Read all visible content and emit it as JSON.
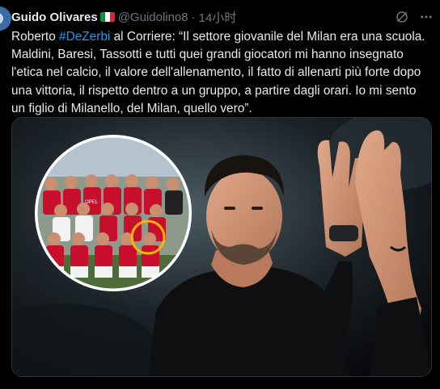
{
  "author": {
    "name": "Guido Olivares",
    "handle": "@Guidolino8",
    "separator": "·",
    "time": "14小时"
  },
  "tweet": {
    "line1_pre": "Roberto ",
    "line1_hashtag": "#DeZerbi",
    "line1_post": " al Corriere: “Il settore giovanile del Milan era una scuola.",
    "line2": "Maldini, Baresi, Tassotti e tutti quei grandi giocatori mi hanno insegnato",
    "line3": "l'etica nel calcio, il valore dell'allenamento, il fatto di allenarti più forte dopo",
    "line4": "una vittoria, il rispetto dentro a un gruppo, a partire dagli orari. Io mi sento",
    "line5": "un figlio di Milanello, del Milan, quello vero”."
  },
  "media": {
    "inset_photo": {
      "shirt_text": "OPEL"
    }
  },
  "icons": {
    "flag": "italy-flag-icon",
    "mute": "mute-icon",
    "more": "more-icon"
  },
  "colors": {
    "background": "#000000",
    "text": "#e7e9ea",
    "secondary": "#71767b",
    "link": "#1d9bf0",
    "milan_red": "#c8102e",
    "highlight_circle": "#f5b800"
  }
}
